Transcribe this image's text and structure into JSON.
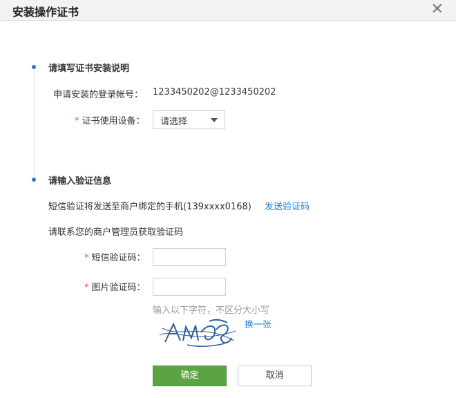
{
  "window": {
    "title": "安装操作证书",
    "close_symbol": "✕"
  },
  "sections": [
    {
      "title": "请填写证书安装说明",
      "login_label": "申请安装的登录帐号：",
      "login_value": "1233450202@1233450202",
      "device_label": "证书使用设备：",
      "device_select_value": "请选择"
    },
    {
      "title": "请输入验证信息",
      "sms_notice": "短信验证将发送至商户绑定的手机(139xxxx0168)",
      "send_code_link": "发送验证码",
      "contact_note": "请联系您的商户管理员获取验证码",
      "sms_code_label": "短信验证码：",
      "sms_code_value": "",
      "image_code_label": "图片验证码：",
      "image_code_value": "",
      "captcha_hint": "输入以下字符，不区分大小写",
      "refresh_captcha_link": "换一张"
    }
  ],
  "buttons": {
    "confirm": "确定",
    "cancel": "取消"
  },
  "required_mark": "*",
  "colors": {
    "accent": "#1f7fd0",
    "primary_button": "#5ba345",
    "required": "#d9534f",
    "captcha_ink": "#2a5fa0"
  }
}
